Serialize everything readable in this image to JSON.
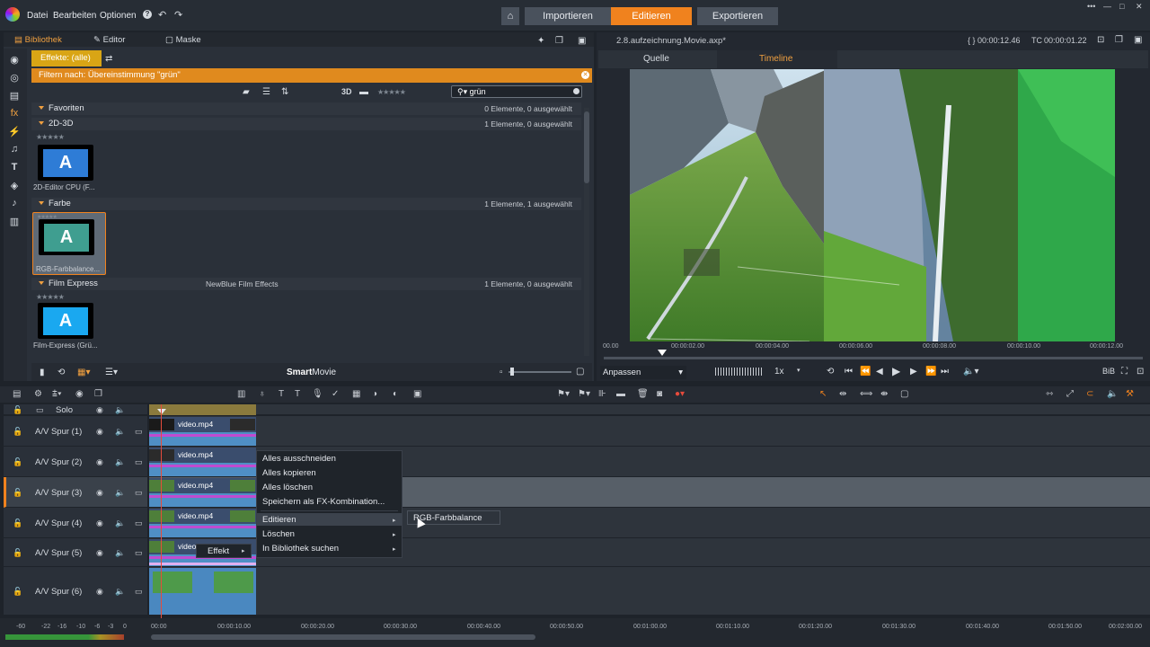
{
  "menu": {
    "file": "Datei",
    "edit": "Bearbeiten",
    "options": "Optionen",
    "help": "?"
  },
  "modes": {
    "import": "Importieren",
    "edit": "Editieren",
    "export": "Exportieren"
  },
  "window_controls": [
    "•••",
    "—",
    "□",
    "✕"
  ],
  "library": {
    "tabs": {
      "library": "Bibliothek",
      "editor": "Editor",
      "mask": "Maske"
    },
    "effects_tag": "Effekte: (alle)",
    "filter_text": "Filtern nach:  Übereinstimmung \"grün\"",
    "view_3d": "3D",
    "stars": "★★★★★",
    "search_value": "grün",
    "categories": [
      {
        "name": "Favoriten",
        "sub": "",
        "count": "0 Elemente, 0 ausgewählt"
      },
      {
        "name": "2D-3D",
        "sub": "",
        "count": "1 Elemente, 0 ausgewählt"
      },
      {
        "name": "Farbe",
        "sub": "",
        "count": "1 Elemente, 1 ausgewählt"
      },
      {
        "name": "Film Express",
        "sub": "NewBlue Film Effects",
        "count": "1 Elemente, 0 ausgewählt"
      }
    ],
    "thumbs": [
      {
        "label": "2D-Editor CPU (F...",
        "letter": "A"
      },
      {
        "label": "RGB-Farbbalance...",
        "letter": "A"
      },
      {
        "label": "Film-Express (Grü...",
        "letter": "A"
      }
    ],
    "bottom": {
      "smart": "Smart",
      "movie": "Movie"
    }
  },
  "preview": {
    "title": "2.8.aufzeichnung.Movie.axp*",
    "tc_duration": "{ } 00:00:12.46",
    "tc_label": "TC",
    "tc_current": "00:00:01.22",
    "tabs": {
      "source": "Quelle",
      "timeline": "Timeline"
    },
    "ruler": [
      "00.00",
      "00:00:02.00",
      "00:00:04.00",
      "00:00:06.00",
      "00:00:08.00",
      "00:00:10.00",
      "00:00:12.00"
    ],
    "fit": "Anpassen",
    "speed": "1x",
    "pip": "BiB"
  },
  "timeline": {
    "solo": "Solo",
    "tracks": [
      {
        "name": "A/V Spur (1)",
        "clip": "video.mp4"
      },
      {
        "name": "A/V Spur (2)",
        "clip": "video.mp4"
      },
      {
        "name": "A/V Spur (3)",
        "clip": "video.mp4"
      },
      {
        "name": "A/V Spur (4)",
        "clip": "video.mp4"
      },
      {
        "name": "A/V Spur (5)",
        "clip": "video"
      },
      {
        "name": "A/V Spur (6)",
        "clip": ""
      }
    ],
    "ruler": [
      "00:00",
      "00:00:10.00",
      "00:00:20.00",
      "00:00:30.00",
      "00:00:40.00",
      "00:00:50.00",
      "00:01:00.00",
      "00:01:10.00",
      "00:01:20.00",
      "00:01:30.00",
      "00:01:40.00",
      "00:01:50.00",
      "00:02:00.00"
    ],
    "vu_ticks": [
      "-60",
      "-22",
      "-16",
      "-10",
      "-6",
      "-3",
      "0"
    ]
  },
  "context_menu": {
    "items": [
      "Alles ausschneiden",
      "Alles kopieren",
      "Alles löschen",
      "Speichern als FX-Kombination...",
      "Editieren",
      "Löschen",
      "In Bibliothek suchen"
    ],
    "submenu": "RGB-Farbbalance",
    "effekt": "Effekt"
  }
}
